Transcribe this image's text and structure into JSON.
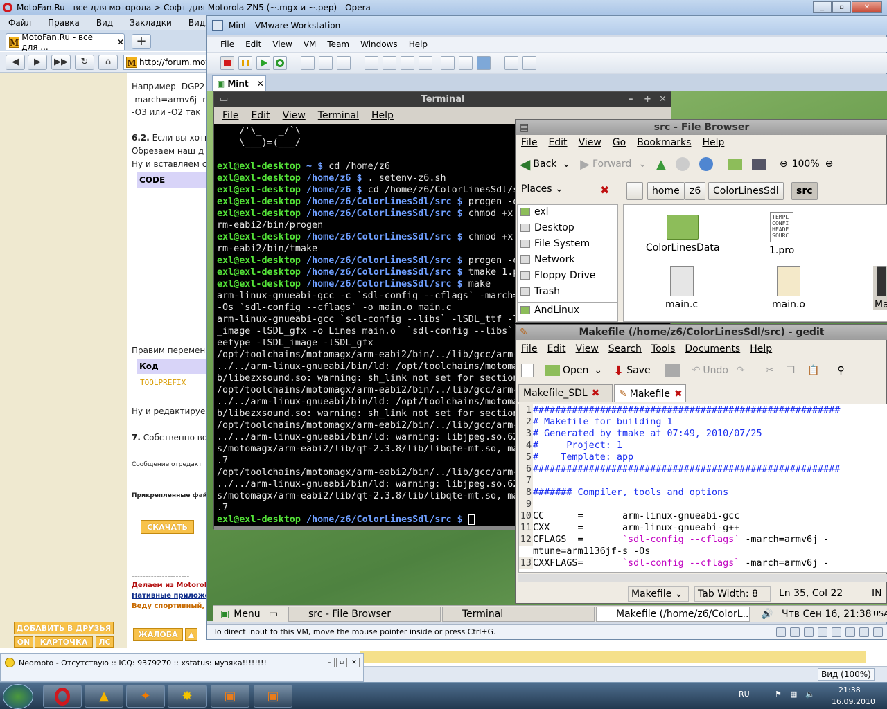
{
  "opera": {
    "title": "MotoFan.Ru - все для моторола > Софт для Motorola ZN5 (~.mgx и ~.pep) - Opera",
    "menu": [
      "Файл",
      "Правка",
      "Вид",
      "Закладки",
      "Виджеты"
    ],
    "tab_label": "MotoFan.Ru - все для ...",
    "tab_badge": "M",
    "url": "http://forum.mot",
    "page": {
      "lines_top": [
        "Например -DGP2",
        "-march=armv6j -r",
        "-O3 или -O2 так"
      ],
      "section_62_num": "6.2.",
      "section_62_text": " Если вы хоти",
      "line_a": "Обрезаем наш д",
      "line_b": "Ну и вставляем с",
      "code_header": "CODE",
      "edit_vars": "Правим перемен",
      "code_header2": "Код",
      "toolprefix": "TOOLPREFIX",
      "edit_line": "Ну и редактируе",
      "section_7_num": "7.",
      "section_7_text": " Собственно во",
      "msg_edited": "Сообщение отредакт",
      "attached": "Прикрепленные фай",
      "download": "СКАЧАТЬ",
      "divider": "---------------------",
      "link1": "Делаем из Motorol",
      "link2": "Нативные приложе",
      "link3": "Веду спортивный, "
    },
    "bottom_buttons": {
      "add_friend": "ДОБАВИТЬ В ДРУЗЬЯ",
      "on": "ON",
      "card": "КАРТОЧКА",
      "ls": "ЛС",
      "complaint": "ЖАЛОБА"
    },
    "zoom": "Вид (100%)"
  },
  "neomoto": {
    "title": "Neomoto - Отсутствую :: ICQ: 9379270 :: xstatus: музяка!!!!!!!!"
  },
  "vmware": {
    "title": "Mint - VMware Workstation",
    "menu": [
      "File",
      "Edit",
      "View",
      "VM",
      "Team",
      "Windows",
      "Help"
    ],
    "tab": "Mint",
    "status": "To direct input to this VM, move the mouse pointer inside or press Ctrl+G."
  },
  "terminal": {
    "title": "Terminal",
    "menu": [
      "File",
      "Edit",
      "View",
      "Terminal",
      "Help"
    ],
    "lines": [
      {
        "t": "text",
        "v": "    /'\\_   _/`\\"
      },
      {
        "t": "text",
        "v": "    \\___)=(___/"
      },
      {
        "t": "text",
        "v": ""
      },
      {
        "t": "prompt",
        "u": "exl@exl-desktop",
        "p": " ~ $",
        "c": " cd /home/z6"
      },
      {
        "t": "prompt",
        "u": "exl@exl-desktop",
        "p": " /home/z6 $",
        "c": " . setenv-z6.sh"
      },
      {
        "t": "prompt",
        "u": "exl@exl-desktop",
        "p": " /home/z6 $",
        "c": " cd /home/z6/ColorLinesSdl/src"
      },
      {
        "t": "prompt",
        "u": "exl@exl-desktop",
        "p": " /home/z6/ColorLinesSdl/src $",
        "c": " progen -o"
      },
      {
        "t": "prompt",
        "u": "exl@exl-desktop",
        "p": " /home/z6/ColorLinesSdl/src $",
        "c": " chmod +x"
      },
      {
        "t": "text",
        "v": "rm-eabi2/bin/progen"
      },
      {
        "t": "prompt",
        "u": "exl@exl-desktop",
        "p": " /home/z6/ColorLinesSdl/src $",
        "c": " chmod +x"
      },
      {
        "t": "text",
        "v": "rm-eabi2/bin/tmake"
      },
      {
        "t": "prompt",
        "u": "exl@exl-desktop",
        "p": " /home/z6/ColorLinesSdl/src $",
        "c": " progen -o"
      },
      {
        "t": "prompt",
        "u": "exl@exl-desktop",
        "p": " /home/z6/ColorLinesSdl/src $",
        "c": " tmake 1.p"
      },
      {
        "t": "prompt",
        "u": "exl@exl-desktop",
        "p": " /home/z6/ColorLinesSdl/src $",
        "c": " make"
      },
      {
        "t": "text",
        "v": "arm-linux-gnueabi-gcc -c `sdl-config --cflags` -march="
      },
      {
        "t": "text",
        "v": "-Os `sdl-config --cflags` -o main.o main.c"
      },
      {
        "t": "text",
        "v": "arm-linux-gnueabi-gcc `sdl-config --libs` -lSDL_ttf -l"
      },
      {
        "t": "text",
        "v": "_image -lSDL_gfx -o Lines main.o  `sdl-config --libs`"
      },
      {
        "t": "text",
        "v": "eetype -lSDL_image -lSDL_gfx"
      },
      {
        "t": "text",
        "v": "/opt/toolchains/motomagx/arm-eabi2/bin/../lib/gcc/arm-"
      },
      {
        "t": "text",
        "v": "../../arm-linux-gnueabi/bin/ld: /opt/toolchains/motoma"
      },
      {
        "t": "text",
        "v": "b/libezxsound.so: warning: sh_link not set for section"
      },
      {
        "t": "text",
        "v": "/opt/toolchains/motomagx/arm-eabi2/bin/../lib/gcc/arm-"
      },
      {
        "t": "text",
        "v": "../../arm-linux-gnueabi/bin/ld: /opt/toolchains/motoma"
      },
      {
        "t": "text",
        "v": "b/libezxsound.so: warning: sh_link not set for section"
      },
      {
        "t": "text",
        "v": "/opt/toolchains/motomagx/arm-eabi2/bin/../lib/gcc/arm-"
      },
      {
        "t": "text",
        "v": "../../arm-linux-gnueabi/bin/ld: warning: libjpeg.so.62"
      },
      {
        "t": "text",
        "v": "s/motomagx/arm-eabi2/lib/qt-2.3.8/lib/libqte-mt.so, ma"
      },
      {
        "t": "text",
        "v": ".7"
      },
      {
        "t": "text",
        "v": "/opt/toolchains/motomagx/arm-eabi2/bin/../lib/gcc/arm-"
      },
      {
        "t": "text",
        "v": "../../arm-linux-gnueabi/bin/ld: warning: libjpeg.so.62"
      },
      {
        "t": "text",
        "v": "s/motomagx/arm-eabi2/lib/qt-2.3.8/lib/libqte-mt.so, ma"
      },
      {
        "t": "text",
        "v": ".7"
      },
      {
        "t": "prompt",
        "u": "exl@exl-desktop",
        "p": " /home/z6/ColorLinesSdl/src $",
        "c": " ",
        "cursor": true
      }
    ]
  },
  "filebrowser": {
    "title": "src - File Browser",
    "menu": [
      "File",
      "Edit",
      "View",
      "Go",
      "Bookmarks",
      "Help"
    ],
    "back": "Back",
    "forward": "Forward",
    "zoom": "100%",
    "places": "Places",
    "crumbs": [
      "home",
      "z6",
      "ColorLinesSdl",
      "src"
    ],
    "sidebar": [
      "exl",
      "Desktop",
      "File System",
      "Network",
      "Floppy Drive",
      "Trash",
      "AndLinux"
    ],
    "files": [
      "ColorLinesData",
      "1.pro",
      "main.c",
      "main.o",
      "Ma"
    ],
    "pro_preview": "TEMPL\nCONFI\nHEADE\nSOURC"
  },
  "gedit": {
    "title": "Makefile (/home/z6/ColorLinesSdl/src) - gedit",
    "menu": [
      "File",
      "Edit",
      "View",
      "Search",
      "Tools",
      "Documents",
      "Help"
    ],
    "open": "Open",
    "save": "Save",
    "undo": "Undo",
    "tabs": [
      "Makefile_SDL",
      "Makefile"
    ],
    "lines": [
      {
        "n": "1",
        "k": "cm",
        "v": "#######################################################"
      },
      {
        "n": "2",
        "k": "cm",
        "v": "# Makefile for building 1"
      },
      {
        "n": "3",
        "k": "cm",
        "v": "# Generated by tmake at 07:49, 2010/07/25"
      },
      {
        "n": "4",
        "k": "cm",
        "v": "#     Project: 1"
      },
      {
        "n": "5",
        "k": "cm",
        "v": "#    Template: app"
      },
      {
        "n": "6",
        "k": "cm",
        "v": "#######################################################"
      },
      {
        "n": "7",
        "k": "",
        "v": ""
      },
      {
        "n": "8",
        "k": "cm",
        "v": "####### Compiler, tools and options"
      },
      {
        "n": "9",
        "k": "",
        "v": ""
      },
      {
        "n": "10",
        "k": "",
        "v": "CC      =       arm-linux-gnueabi-gcc"
      },
      {
        "n": "11",
        "k": "",
        "v": "CXX     =       arm-linux-gnueabi-g++"
      },
      {
        "n": "12",
        "k": "mix",
        "a": "CFLAGS  =       ",
        "s": "`sdl-config --cflags`",
        "b": " -march=armv6j -"
      },
      {
        "n": "",
        "k": "",
        "v": "mtune=arm1136jf-s -Os"
      },
      {
        "n": "13",
        "k": "mix",
        "a": "CXXFLAGS=       ",
        "s": "`sdl-config --cflags`",
        "b": " -march=armv6j -"
      }
    ],
    "status": {
      "lang": "Makefile",
      "tab": "Tab Width: 8",
      "pos": "Ln 35, Col 22",
      "ins": "IN"
    }
  },
  "panel": {
    "menu": "Menu",
    "items": [
      "src - File Browser",
      "Terminal",
      "Makefile (/home/z6/ColorL..."
    ],
    "clock": "Чтв Сен 16, 21:38",
    "kb": "USA"
  },
  "taskbar": {
    "lang": "RU",
    "time": "21:38",
    "date": "16.09.2010"
  }
}
